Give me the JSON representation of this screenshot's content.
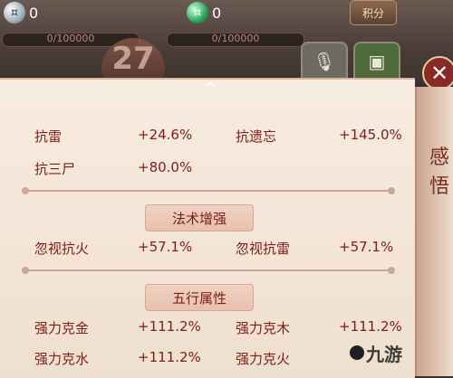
{
  "hud": {
    "silver_count": "0",
    "jade_count": "0",
    "progress_left": "0/100000",
    "progress_right": "0/100000",
    "round_number": "27",
    "points_label": "积分"
  },
  "panel": {
    "rows": [
      {
        "name1": "抗雷",
        "val1": "+24.6%",
        "name2": "抗遗忘",
        "val2": "+145.0%"
      },
      {
        "name1": "抗三尸",
        "val1": "+80.0%",
        "name2": "",
        "val2": ""
      }
    ],
    "section1_title": "法术增强",
    "section1_rows": [
      {
        "name1": "忽视抗火",
        "val1": "+57.1%",
        "name2": "忽视抗雷",
        "val2": "+57.1%"
      }
    ],
    "section2_title": "五行属性",
    "section2_rows": [
      {
        "name1": "强力克金",
        "val1": "+111.2%",
        "name2": "强力克木",
        "val2": "+111.2%"
      },
      {
        "name1": "强力克水",
        "val1": "+111.2%",
        "name2": "强力克火",
        "val2": ""
      }
    ]
  },
  "side_panel": {
    "chars": [
      "感",
      "悟"
    ]
  },
  "watermark": "九游"
}
